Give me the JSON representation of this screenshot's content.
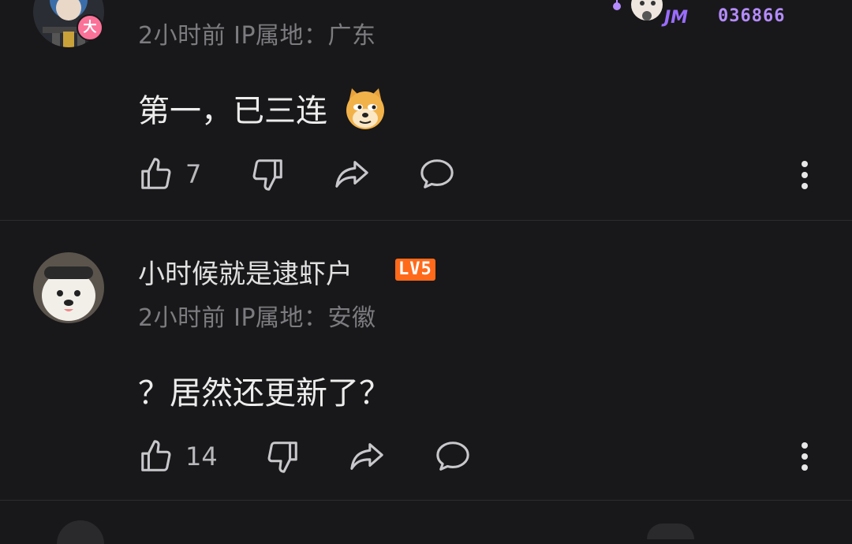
{
  "comments": [
    {
      "username": "",
      "meta": "2小时前 IP属地：广东",
      "content": "第一，已三连",
      "emoji": "doge-emoji",
      "likes": "7",
      "avatar_badge": "大",
      "fan_badge": {
        "number": "036866",
        "art_text": "JM"
      }
    },
    {
      "username": "小时候就是逮虾户",
      "level": "LV5",
      "meta": "2小时前 IP属地：安徽",
      "content": "？居然还更新了？",
      "likes": "14"
    }
  ],
  "colors": {
    "background": "#18181a",
    "meta_text": "#7c7c80",
    "level_badge": "#ff6a1a",
    "fan_number": "#b58cff"
  }
}
